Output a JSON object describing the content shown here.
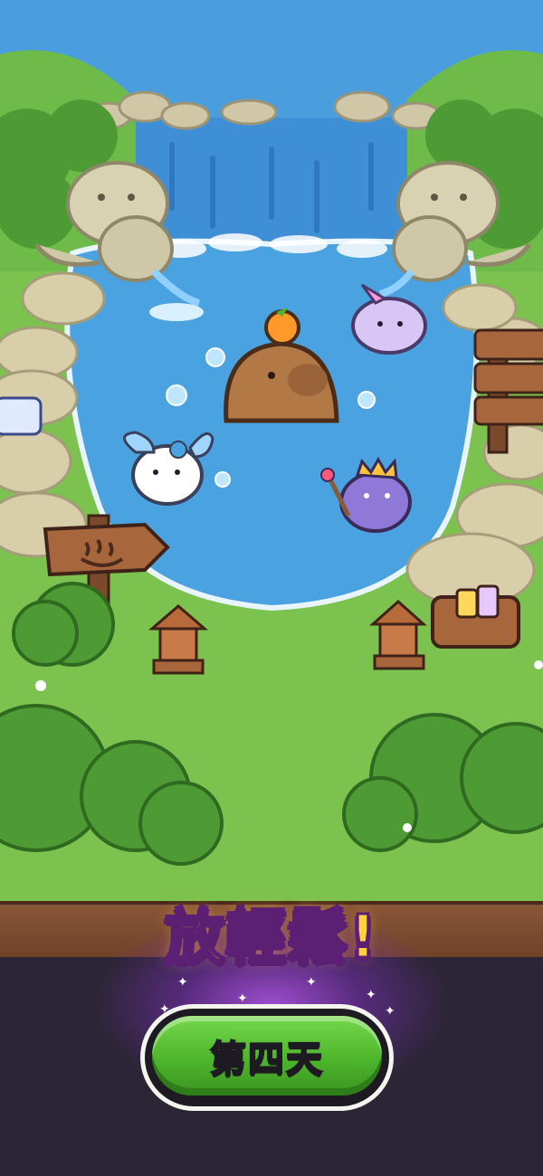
{
  "banner": {
    "title": "放輕鬆!"
  },
  "action": {
    "day_button_label": "第四天"
  },
  "signpost": {
    "icon": "hot-spring-icon"
  },
  "colors": {
    "title_fill": "#ffd23a",
    "title_outline": "#5b1f74",
    "button_green": "#4db52c",
    "glow_purple": "#c45aff",
    "water": "#4aa3e0"
  }
}
